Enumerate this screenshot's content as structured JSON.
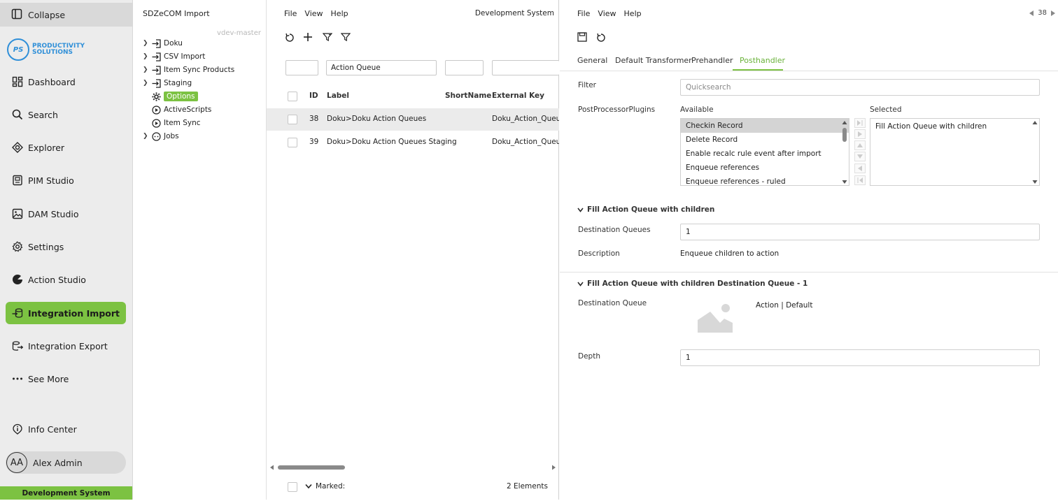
{
  "sidebar": {
    "collapse_label": "Collapse",
    "logo": {
      "mark": "PS",
      "line1": "PRODUCTIVITY",
      "line2": "SOLUTIONS"
    },
    "items": [
      {
        "label": "Dashboard",
        "icon": "dashboard-icon"
      },
      {
        "label": "Search",
        "icon": "search-icon"
      },
      {
        "label": "Explorer",
        "icon": "explorer-icon"
      },
      {
        "label": "PIM Studio",
        "icon": "pim-studio-icon"
      },
      {
        "label": "DAM Studio",
        "icon": "image-icon"
      },
      {
        "label": "Settings",
        "icon": "gear-icon"
      },
      {
        "label": "Action Studio",
        "icon": "action-studio-icon"
      },
      {
        "label": "Integration Import",
        "icon": "integration-import-icon",
        "active": true
      },
      {
        "label": "Integration Export",
        "icon": "integration-export-icon"
      },
      {
        "label": "See More",
        "icon": "more-dots-icon"
      }
    ],
    "info_center": "Info Center",
    "user": {
      "initials": "AA",
      "name": "Alex Admin"
    },
    "environment": "Development System",
    "accent": "#7cc242"
  },
  "tree": {
    "title": "SDZeCOM Import",
    "branch": "vdev-master",
    "items": [
      {
        "label": "Doku",
        "expandable": true,
        "icon": "import-icon"
      },
      {
        "label": "CSV Import",
        "expandable": true,
        "icon": "import-icon"
      },
      {
        "label": "Item Sync Products",
        "expandable": true,
        "icon": "import-icon"
      },
      {
        "label": "Staging",
        "expandable": true,
        "icon": "import-icon"
      },
      {
        "label": "Options",
        "expandable": false,
        "icon": "gear-icon",
        "selected": true
      },
      {
        "label": "ActiveScripts",
        "expandable": false,
        "icon": "play-circle-icon"
      },
      {
        "label": "Item Sync",
        "expandable": false,
        "icon": "play-circle-icon"
      },
      {
        "label": "Jobs",
        "expandable": true,
        "icon": "jobs-icon"
      }
    ]
  },
  "list": {
    "menu": [
      "File",
      "View",
      "Help"
    ],
    "environment": "Development System",
    "filters": {
      "id": "",
      "label": "Action Queue",
      "shortname": "",
      "external_key": ""
    },
    "columns": {
      "id": "ID",
      "label": "Label",
      "shortname": "ShortName",
      "external_key": "External Key"
    },
    "rows": [
      {
        "id": "38",
        "label": "Doku>Doku Action Queues",
        "shortname": "",
        "external_key": "Doku_Action_Queues",
        "selected": true
      },
      {
        "id": "39",
        "label": "Doku>Doku Action Queues Staging",
        "shortname": "",
        "external_key": "Doku_Action_Queues_Staging"
      }
    ],
    "footer": {
      "marked_label": "Marked:",
      "count": "2 Elements"
    }
  },
  "detail": {
    "menu": [
      "File",
      "View",
      "Help"
    ],
    "record_number": "38",
    "tabs": [
      "General",
      "Default Transformer",
      "Prehandler",
      "Posthandler"
    ],
    "active_tab": "Posthandler",
    "filter_label": "Filter",
    "filter_placeholder": "Quicksearch",
    "plugins_label": "PostProcessorPlugins",
    "available_label": "Available",
    "selected_label": "Selected",
    "available": [
      "Checkin Record",
      "Delete Record",
      "Enable recalc rule event after import",
      "Enqueue references",
      "Enqueue references - ruled"
    ],
    "selected": [
      "Fill Action Queue with children"
    ],
    "section1": {
      "title": "Fill Action Queue with children",
      "dest_queues_label": "Destination Queues",
      "dest_queues_value": "1",
      "description_label": "Description",
      "description_value": "Enqueue children to action"
    },
    "section2": {
      "title": "Fill Action Queue with children Destination Queue - 1",
      "dest_queue_label": "Destination Queue",
      "dest_queue_value": "Action | Default",
      "depth_label": "Depth",
      "depth_value": "1"
    }
  }
}
